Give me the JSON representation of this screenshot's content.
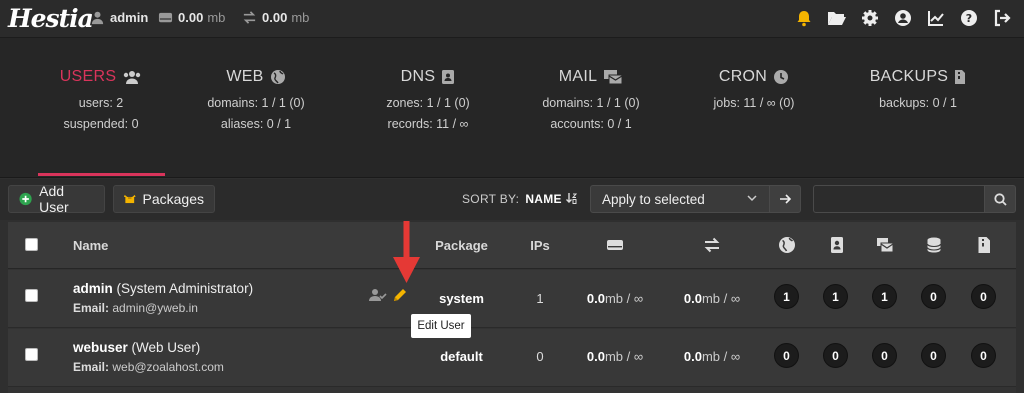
{
  "topbar": {
    "logo": "Hestia",
    "user": "admin",
    "disk_value": "0.00",
    "disk_unit": "mb",
    "bw_value": "0.00",
    "bw_unit": "mb"
  },
  "stats": [
    {
      "title": "USERS",
      "line1": "users: 2",
      "line2": "suspended: 0",
      "active": true
    },
    {
      "title": "WEB",
      "line1": "domains: 1 / 1 (0)",
      "line2": "aliases: 0 / 1"
    },
    {
      "title": "DNS",
      "line1": "zones: 1 / 1 (0)",
      "line2": "records: 11 / ∞"
    },
    {
      "title": "MAIL",
      "line1": "domains: 1 / 1 (0)",
      "line2": "accounts: 0 / 1"
    },
    {
      "title": "CRON",
      "line1": "jobs: 11 / ∞ (0)",
      "line2": ""
    },
    {
      "title": "BACKUPS",
      "line1": "backups: 0 / 1",
      "line2": ""
    }
  ],
  "toolbar": {
    "add_user": "Add User",
    "packages": "Packages",
    "sort_label": "SORT BY:",
    "sort_value": "NAME",
    "bulk_select": "Apply to selected",
    "search_placeholder": ""
  },
  "table": {
    "headers": {
      "name": "Name",
      "package": "Package",
      "ips": "IPs"
    },
    "rows": [
      {
        "username": "admin",
        "fullname": "(System Administrator)",
        "email_label": "Email:",
        "email": "admin@yweb.in",
        "package": "system",
        "ips": "1",
        "disk_value": "0.0",
        "disk_unit": "mb / ∞",
        "bw_value": "0.0",
        "bw_unit": "mb / ∞",
        "web": "1",
        "dns": "1",
        "mail": "1",
        "db": "0",
        "backups": "0"
      },
      {
        "username": "webuser",
        "fullname": "(Web User)",
        "email_label": "Email:",
        "email": "web@zoalahost.com",
        "package": "default",
        "ips": "0",
        "disk_value": "0.0",
        "disk_unit": "mb / ∞",
        "bw_value": "0.0",
        "bw_unit": "mb / ∞",
        "web": "0",
        "dns": "0",
        "mail": "0",
        "db": "0",
        "backups": "0"
      }
    ]
  },
  "tooltip": "Edit User",
  "colors": {
    "accent": "#d9345b",
    "icon_yellow": "#f4b400",
    "add_green": "#2ea44f",
    "arrow_red": "#e53935"
  }
}
